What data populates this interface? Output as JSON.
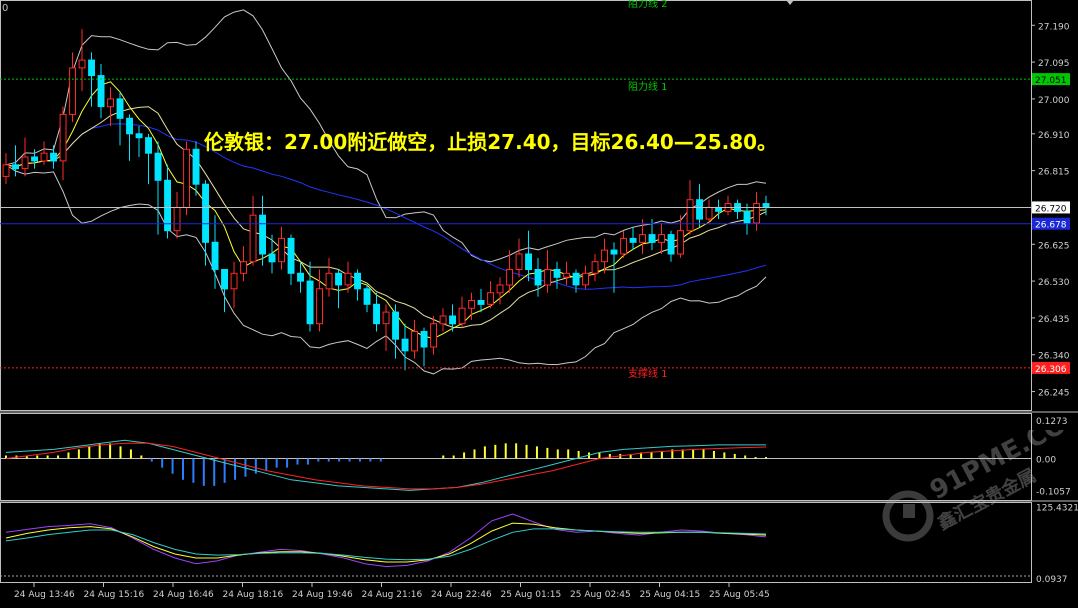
{
  "headline": "伦敦银：27.00附近做空，止损27.40，目标26.40—25.80。",
  "corner_label": "0",
  "levels": {
    "resistance2_label": "阻力线 2",
    "resistance1_label": "阻力线 1",
    "resistance1_value": 27.051,
    "resistance1_tag": "27.051",
    "support1_label": "支撑线 1",
    "support1_value": 26.306,
    "support1_tag": "26.306",
    "current_price": 26.72,
    "current_price_tag": "26.720",
    "blue_line_value": 26.678,
    "blue_line_tag": "26.678"
  },
  "watermark": {
    "text": "91PME.COM",
    "subtext": "鑫汇宝贵金属"
  },
  "colors": {
    "background": "#000000",
    "up_candle": "#ff2a2a",
    "down_candle": "#00e5ff",
    "bollinger": "#c8c8c8",
    "ma_fast": "#ffff33",
    "ma_slow": "#2233ff",
    "resistance": "#00c800",
    "support": "#ff2020",
    "headline": "#ffff00"
  },
  "chart_data": [
    {
      "type": "candlestick",
      "title": "",
      "ylim": [
        26.2,
        27.25
      ],
      "y_ticks": [
        "27.190",
        "27.095",
        "27.000",
        "26.910",
        "26.815",
        "26.720",
        "26.625",
        "26.530",
        "26.435",
        "26.340",
        "26.245"
      ],
      "x_ticks": [
        "24 Aug 13:46",
        "24 Aug 15:16",
        "24 Aug 16:46",
        "24 Aug 18:16",
        "24 Aug 19:46",
        "24 Aug 21:16",
        "24 Aug 22:46",
        "25 Aug 01:15",
        "25 Aug 02:45",
        "25 Aug 04:15",
        "25 Aug 05:45"
      ],
      "candles": [
        [
          26.8,
          26.83,
          26.86,
          26.78
        ],
        [
          26.83,
          26.82,
          26.88,
          26.8
        ],
        [
          26.82,
          26.85,
          26.9,
          26.8
        ],
        [
          26.85,
          26.84,
          26.87,
          26.82
        ],
        [
          26.84,
          26.86,
          26.89,
          26.83
        ],
        [
          26.86,
          26.84,
          26.88,
          26.82
        ],
        [
          26.84,
          26.96,
          26.98,
          26.79
        ],
        [
          26.96,
          27.08,
          27.12,
          26.94
        ],
        [
          27.08,
          27.1,
          27.18,
          27.02
        ],
        [
          27.1,
          27.06,
          27.12,
          26.98
        ],
        [
          27.06,
          26.98,
          27.09,
          26.95
        ],
        [
          26.98,
          27.0,
          27.03,
          26.93
        ],
        [
          27.0,
          26.95,
          27.02,
          26.88
        ],
        [
          26.95,
          26.91,
          26.96,
          26.84
        ],
        [
          26.91,
          26.9,
          26.93,
          26.85
        ],
        [
          26.9,
          26.86,
          26.91,
          26.78
        ],
        [
          26.86,
          26.79,
          26.89,
          26.65
        ],
        [
          26.79,
          26.66,
          26.83,
          26.64
        ],
        [
          26.66,
          26.72,
          26.76,
          26.64
        ],
        [
          26.72,
          26.87,
          26.89,
          26.7
        ],
        [
          26.87,
          26.78,
          26.89,
          26.75
        ],
        [
          26.78,
          26.63,
          26.79,
          26.57
        ],
        [
          26.63,
          26.56,
          26.7,
          26.51
        ],
        [
          26.56,
          26.51,
          26.56,
          26.45
        ],
        [
          26.51,
          26.55,
          26.58,
          26.46
        ],
        [
          26.55,
          26.58,
          26.62,
          26.53
        ],
        [
          26.58,
          26.7,
          26.75,
          26.57
        ],
        [
          26.7,
          26.6,
          26.75,
          26.57
        ],
        [
          26.6,
          26.58,
          26.65,
          26.55
        ],
        [
          26.58,
          26.64,
          26.67,
          26.56
        ],
        [
          26.64,
          26.55,
          26.65,
          26.52
        ],
        [
          26.55,
          26.53,
          26.58,
          26.5
        ],
        [
          26.53,
          26.42,
          26.58,
          26.4
        ],
        [
          26.42,
          26.51,
          26.56,
          26.4
        ],
        [
          26.51,
          26.55,
          26.59,
          26.49
        ],
        [
          26.55,
          26.52,
          26.56,
          26.46
        ],
        [
          26.52,
          26.55,
          26.58,
          26.5
        ],
        [
          26.55,
          26.51,
          26.56,
          26.48
        ],
        [
          26.51,
          26.47,
          26.52,
          26.45
        ],
        [
          26.47,
          26.42,
          26.5,
          26.4
        ],
        [
          26.42,
          26.45,
          26.47,
          26.35
        ],
        [
          26.45,
          26.38,
          26.47,
          26.33
        ],
        [
          26.38,
          26.35,
          26.42,
          26.3
        ],
        [
          26.35,
          26.4,
          26.43,
          26.33
        ],
        [
          26.4,
          26.36,
          26.41,
          26.31
        ],
        [
          26.36,
          26.42,
          26.44,
          26.34
        ],
        [
          26.42,
          26.44,
          26.46,
          26.4
        ],
        [
          26.44,
          26.42,
          26.47,
          26.4
        ],
        [
          26.42,
          26.46,
          26.49,
          26.41
        ],
        [
          26.46,
          26.48,
          26.5,
          26.43
        ],
        [
          26.48,
          26.47,
          26.51,
          26.45
        ],
        [
          26.47,
          26.5,
          26.53,
          26.46
        ],
        [
          26.5,
          26.52,
          26.54,
          26.47
        ],
        [
          26.52,
          26.56,
          26.61,
          26.5
        ],
        [
          26.56,
          26.6,
          26.64,
          26.54
        ],
        [
          26.6,
          26.56,
          26.66,
          26.53
        ],
        [
          26.56,
          26.52,
          26.59,
          26.49
        ],
        [
          26.52,
          26.56,
          26.61,
          26.5
        ],
        [
          26.56,
          26.54,
          26.58,
          26.51
        ],
        [
          26.54,
          26.55,
          26.58,
          26.52
        ],
        [
          26.55,
          26.52,
          26.56,
          26.5
        ],
        [
          26.52,
          26.55,
          26.57,
          26.51
        ],
        [
          26.55,
          26.58,
          26.6,
          26.53
        ],
        [
          26.58,
          26.61,
          26.64,
          26.55
        ],
        [
          26.61,
          26.6,
          26.63,
          26.5
        ],
        [
          26.6,
          26.64,
          26.66,
          26.59
        ],
        [
          26.64,
          26.63,
          26.67,
          26.61
        ],
        [
          26.63,
          26.65,
          26.69,
          26.6
        ],
        [
          26.65,
          26.63,
          26.69,
          26.61
        ],
        [
          26.63,
          26.65,
          26.68,
          26.6
        ],
        [
          26.65,
          26.6,
          26.66,
          26.58
        ],
        [
          26.6,
          26.66,
          26.7,
          26.59
        ],
        [
          26.66,
          26.74,
          26.79,
          26.65
        ],
        [
          26.74,
          26.69,
          26.78,
          26.67
        ],
        [
          26.69,
          26.72,
          26.74,
          26.68
        ],
        [
          26.72,
          26.71,
          26.74,
          26.69
        ],
        [
          26.71,
          26.73,
          26.75,
          26.7
        ],
        [
          26.73,
          26.71,
          26.74,
          26.69
        ],
        [
          26.71,
          26.68,
          26.73,
          26.65
        ],
        [
          26.68,
          26.73,
          26.76,
          26.66
        ],
        [
          26.73,
          26.72,
          26.75,
          26.7
        ]
      ]
    },
    {
      "type": "bar",
      "title": "",
      "ylim": [
        -0.13,
        0.14
      ],
      "y_ticks": [
        "0.1273",
        "0.00",
        "-0.1057"
      ],
      "histogram": [
        0.01,
        0.01,
        0.01,
        0.01,
        0.01,
        0.01,
        0.02,
        0.03,
        0.04,
        0.05,
        0.05,
        0.04,
        0.03,
        0.01,
        -0.01,
        -0.03,
        -0.05,
        -0.07,
        -0.08,
        -0.09,
        -0.09,
        -0.08,
        -0.07,
        -0.06,
        -0.05,
        -0.04,
        -0.03,
        -0.03,
        -0.02,
        -0.02,
        -0.01,
        -0.01,
        -0.01,
        -0.01,
        -0.01,
        -0.01,
        -0.01,
        0.0,
        0.0,
        0.0,
        0.0,
        0.0,
        0.01,
        0.01,
        0.02,
        0.03,
        0.04,
        0.045,
        0.05,
        0.05,
        0.045,
        0.04,
        0.035,
        0.03,
        0.03,
        0.025,
        0.02,
        0.02,
        0.015,
        0.015,
        0.015,
        0.02,
        0.02,
        0.025,
        0.03,
        0.03,
        0.03,
        0.03,
        0.025,
        0.02,
        0.015,
        0.01,
        0.005,
        0.005
      ],
      "series": [
        {
          "name": "",
          "values": [
            0.02,
            0.025,
            0.03,
            0.04,
            0.05,
            0.06,
            0.05,
            0.03,
            0.01,
            -0.01,
            -0.03,
            -0.05,
            -0.07,
            -0.08,
            -0.09,
            -0.095,
            -0.1,
            -0.105,
            -0.1,
            -0.095,
            -0.08,
            -0.06,
            -0.04,
            -0.02,
            0.0,
            0.02,
            0.03,
            0.035,
            0.04,
            0.042,
            0.045,
            0.045,
            0.045
          ]
        },
        {
          "name": "",
          "values": [
            0.0,
            0.01,
            0.02,
            0.035,
            0.045,
            0.05,
            0.05,
            0.04,
            0.02,
            0.0,
            -0.02,
            -0.04,
            -0.055,
            -0.07,
            -0.08,
            -0.09,
            -0.095,
            -0.1,
            -0.1,
            -0.095,
            -0.085,
            -0.07,
            -0.055,
            -0.04,
            -0.02,
            0.0,
            0.01,
            0.02,
            0.025,
            0.03,
            0.033,
            0.036,
            0.038
          ]
        }
      ]
    },
    {
      "type": "line",
      "title": "",
      "ylim": [
        0,
        126
      ],
      "y_ticks": [
        "125.4321",
        "0.0937"
      ],
      "series": [
        {
          "name": "",
          "values": [
            80,
            85,
            90,
            92,
            95,
            88,
            70,
            50,
            35,
            25,
            30,
            40,
            45,
            50,
            48,
            42,
            35,
            25,
            20,
            22,
            30,
            45,
            70,
            100,
            112,
            98,
            85,
            80,
            82,
            78,
            75,
            80,
            84,
            82,
            78,
            76,
            72
          ]
        },
        {
          "name": "",
          "values": [
            70,
            78,
            84,
            88,
            90,
            86,
            72,
            55,
            42,
            35,
            35,
            40,
            44,
            46,
            46,
            43,
            38,
            32,
            28,
            28,
            32,
            42,
            60,
            82,
            96,
            94,
            88,
            84,
            82,
            80,
            78,
            79,
            80,
            80,
            78,
            77,
            75
          ]
        },
        {
          "name": "",
          "values": [
            65,
            70,
            76,
            80,
            84,
            84,
            76,
            62,
            50,
            42,
            40,
            41,
            43,
            44,
            44,
            43,
            40,
            36,
            33,
            32,
            33,
            38,
            50,
            66,
            80,
            86,
            86,
            84,
            82,
            81,
            80,
            80,
            80,
            80,
            79,
            78,
            77
          ]
        }
      ]
    }
  ]
}
